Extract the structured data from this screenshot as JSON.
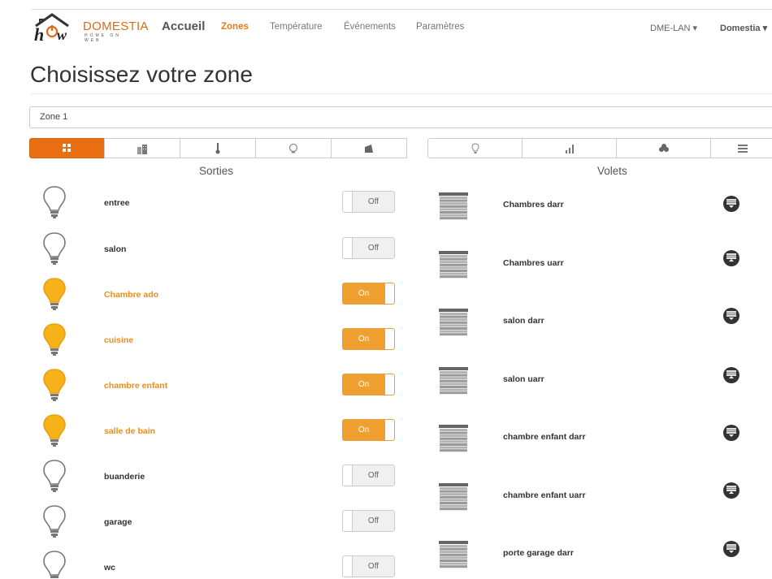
{
  "brand": {
    "logo_text": "DOMESTIA",
    "logo_sub": "HOME ON WEB",
    "accueil": "Accueil"
  },
  "nav": {
    "items": [
      {
        "label": "Zones",
        "active": true
      },
      {
        "label": "Température",
        "active": false
      },
      {
        "label": "Événements",
        "active": false
      },
      {
        "label": "Paramètres",
        "active": false
      }
    ],
    "right": [
      {
        "label": "DME-LAN ▾"
      },
      {
        "label": "Domestia ▾"
      }
    ]
  },
  "page": {
    "title": "Choisissez votre zone",
    "zone_selected": "Zone 1"
  },
  "left_tabs": [
    {
      "icon": "grid-icon",
      "glyph": "▦",
      "active": true
    },
    {
      "icon": "building-icon",
      "glyph": "⌂",
      "active": false
    },
    {
      "icon": "thermometer-icon",
      "glyph": "🌡",
      "active": false
    },
    {
      "icon": "bulb-outline-icon",
      "glyph": "♁",
      "active": false
    },
    {
      "icon": "tag-icon",
      "glyph": "◢",
      "active": false
    }
  ],
  "right_tabs": [
    {
      "icon": "bulb-small-icon",
      "glyph": "♀"
    },
    {
      "icon": "signal-bars-icon",
      "glyph": "ıl"
    },
    {
      "icon": "club-icon",
      "glyph": "♣"
    },
    {
      "icon": "menu-icon",
      "glyph": "≡"
    }
  ],
  "sections": {
    "sorties": "Sorties",
    "volets": "Volets"
  },
  "colors": {
    "accent": "#ea6e12",
    "on_label": "#ef8c16",
    "bulb_on": "#f7b21a",
    "toggle_on": "#f0a030"
  },
  "sorties": [
    {
      "label": "entree",
      "state": "Off",
      "on": false
    },
    {
      "label": "salon",
      "state": "Off",
      "on": false
    },
    {
      "label": "Chambre ado",
      "state": "On",
      "on": true
    },
    {
      "label": "cuisine",
      "state": "On",
      "on": true
    },
    {
      "label": "chambre enfant",
      "state": "On",
      "on": true
    },
    {
      "label": "salle de bain",
      "state": "On",
      "on": true
    },
    {
      "label": "buanderie",
      "state": "Off",
      "on": false
    },
    {
      "label": "garage",
      "state": "Off",
      "on": false
    },
    {
      "label": "wc",
      "state": "Off",
      "on": false
    }
  ],
  "volets": [
    {
      "label": "Chambres darr",
      "action": "down"
    },
    {
      "label": "Chambres uarr",
      "action": "up"
    },
    {
      "label": "salon darr",
      "action": "down"
    },
    {
      "label": "salon uarr",
      "action": "up"
    },
    {
      "label": "chambre enfant darr",
      "action": "down"
    },
    {
      "label": "chambre enfant uarr",
      "action": "up"
    },
    {
      "label": "porte garage darr",
      "action": "down"
    }
  ]
}
